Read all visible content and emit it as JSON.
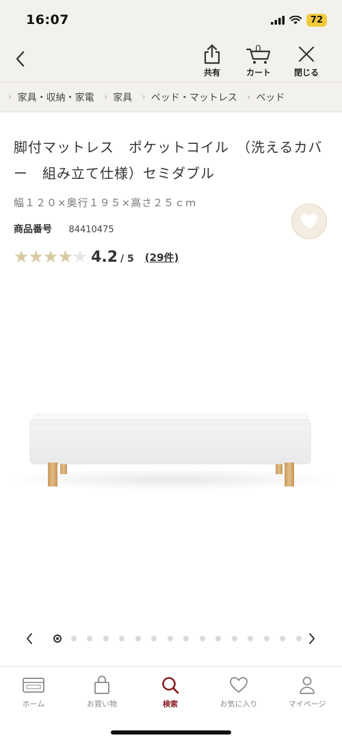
{
  "status_bar": {
    "time": "16:07",
    "battery": "72"
  },
  "nav": {
    "share_label": "共有",
    "cart_label": "カート",
    "cart_count": "0",
    "close_label": "閉じる"
  },
  "breadcrumb": [
    "家具・収納・家電",
    "家具",
    "ベッド・マットレス",
    "ベッド"
  ],
  "product": {
    "title": "脚付マットレス　ポケットコイル　（洗えるカバー　組み立て仕様）セミダブル",
    "size": "幅１２０×奥行１９５×高さ２５ｃｍ",
    "number_label": "商品番号",
    "number": "84410475",
    "rating": 4.2,
    "rating_text": "4.2",
    "rating_max": "/ 5",
    "reviews": "(29件)"
  },
  "carousel": {
    "total_images": 16,
    "active_index": 0
  },
  "tabs": [
    {
      "label": "ホーム",
      "icon": "card-icon"
    },
    {
      "label": "お買い物",
      "icon": "bag-icon"
    },
    {
      "label": "検索",
      "icon": "search-icon",
      "active": true
    },
    {
      "label": "お気に入り",
      "icon": "heart-icon"
    },
    {
      "label": "マイページ",
      "icon": "person-icon"
    }
  ],
  "colors": {
    "accent": "#8b1d24",
    "header_bg": "#f3f1ed",
    "star": "#d8c9a3",
    "fav_bg": "#f3ece1"
  }
}
